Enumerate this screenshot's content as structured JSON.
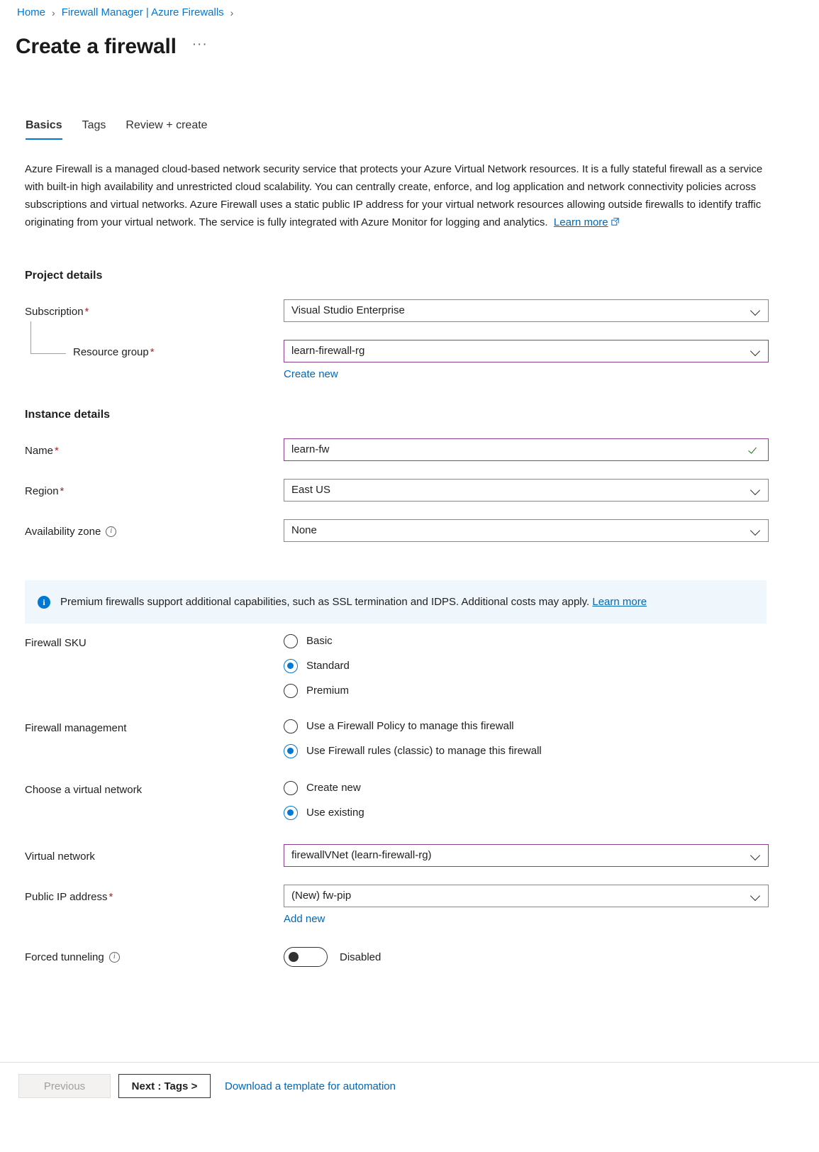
{
  "breadcrumb": {
    "items": [
      {
        "label": "Home"
      },
      {
        "label": "Firewall Manager | Azure Firewalls"
      }
    ],
    "separator": "›"
  },
  "header": {
    "title": "Create a firewall",
    "more_label": "···"
  },
  "tabs": [
    {
      "label": "Basics",
      "active": true
    },
    {
      "label": "Tags",
      "active": false
    },
    {
      "label": "Review + create",
      "active": false
    }
  ],
  "description": {
    "text": "Azure Firewall is a managed cloud-based network security service that protects your Azure Virtual Network resources. It is a fully stateful firewall as a service with built-in high availability and unrestricted cloud scalability. You can centrally create, enforce, and log application and network connectivity policies across subscriptions and virtual networks. Azure Firewall uses a static public IP address for your virtual network resources allowing outside firewalls to identify traffic originating from your virtual network. The service is fully integrated with Azure Monitor for logging and analytics.",
    "learn_more": "Learn more"
  },
  "project_details": {
    "heading": "Project details",
    "subscription": {
      "label": "Subscription",
      "required": "*",
      "value": "Visual Studio Enterprise"
    },
    "resource_group": {
      "label": "Resource group",
      "required": "*",
      "value": "learn-firewall-rg",
      "create_new": "Create new"
    }
  },
  "instance_details": {
    "heading": "Instance details",
    "name": {
      "label": "Name",
      "required": "*",
      "value": "learn-fw"
    },
    "region": {
      "label": "Region",
      "required": "*",
      "value": "East US"
    },
    "availability_zone": {
      "label": "Availability zone",
      "value": "None"
    }
  },
  "banner": {
    "text": "Premium firewalls support additional capabilities, such as SSL termination and IDPS. Additional costs may apply.",
    "link": "Learn more"
  },
  "firewall_sku": {
    "label": "Firewall SKU",
    "options": [
      {
        "label": "Basic",
        "selected": false
      },
      {
        "label": "Standard",
        "selected": true
      },
      {
        "label": "Premium",
        "selected": false
      }
    ]
  },
  "firewall_management": {
    "label": "Firewall management",
    "options": [
      {
        "label": "Use a Firewall Policy to manage this firewall",
        "selected": false
      },
      {
        "label": "Use Firewall rules (classic) to manage this firewall",
        "selected": true
      }
    ]
  },
  "choose_vnet": {
    "label": "Choose a virtual network",
    "options": [
      {
        "label": "Create new",
        "selected": false
      },
      {
        "label": "Use existing",
        "selected": true
      }
    ]
  },
  "virtual_network": {
    "label": "Virtual network",
    "value": "firewallVNet (learn-firewall-rg)"
  },
  "public_ip": {
    "label": "Public IP address",
    "required": "*",
    "value": "(New) fw-pip",
    "add_new": "Add new"
  },
  "forced_tunneling": {
    "label": "Forced tunneling",
    "state_label": "Disabled",
    "enabled": false
  },
  "footer": {
    "previous": "Previous",
    "next": "Next : Tags >",
    "download_template": "Download a template for automation"
  },
  "colors": {
    "accent": "#0078d4",
    "link": "#0067b8",
    "modified_border": "#8c3f8c",
    "required": "#a4262c",
    "success": "#107c10",
    "banner_bg": "#eff6fc"
  }
}
